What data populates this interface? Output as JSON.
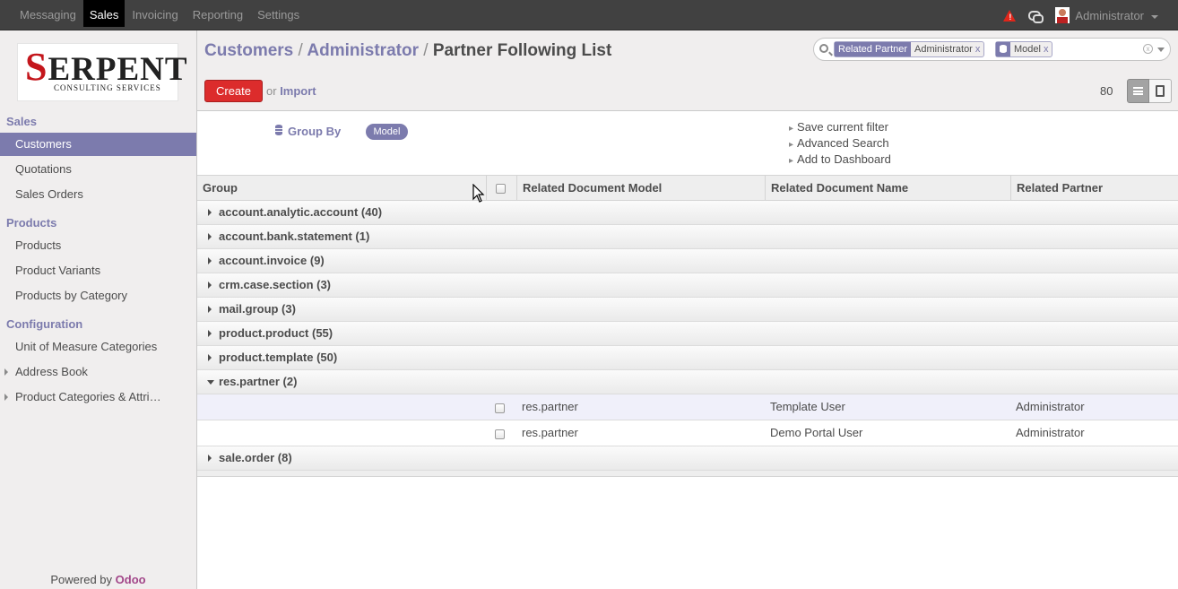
{
  "topbar": {
    "menu": [
      "Messaging",
      "Sales",
      "Invoicing",
      "Reporting",
      "Settings"
    ],
    "active": "Sales",
    "alert_glyph": "!",
    "user": "Administrator"
  },
  "sidebar": {
    "logo_big_first": "S",
    "logo_big_rest": "ERPENT",
    "logo_small": "CONSULTING SERVICES",
    "sections": [
      {
        "title": "Sales",
        "items": [
          "Customers",
          "Quotations",
          "Sales Orders"
        ]
      },
      {
        "title": "Products",
        "items": [
          "Products",
          "Product Variants",
          "Products by Category"
        ]
      },
      {
        "title": "Configuration",
        "items": [
          "Unit of Measure Categories",
          "Address Book",
          "Product Categories & Attri…"
        ]
      }
    ],
    "active_item": "Customers",
    "powered_prefix": "Powered by ",
    "powered_brand": "Odoo"
  },
  "header": {
    "crumb1": "Customers",
    "crumb2": "Administrator",
    "crumb3": "Partner Following List",
    "sep": "/",
    "create_label": "Create",
    "or_label": "or",
    "import_label": "Import",
    "record_count": "80"
  },
  "search": {
    "facet1_label": "Related Partner",
    "facet1_value": "Administrator",
    "facet2_value": "Model",
    "remove": "x",
    "clear": "x"
  },
  "filters": {
    "group_by_label": "Group By",
    "group_by_tag": "Model",
    "options": [
      "Save current filter",
      "Advanced Search",
      "Add to Dashboard"
    ]
  },
  "table": {
    "columns": [
      "Group",
      "Related Document Model",
      "Related Document Name",
      "Related Partner"
    ],
    "groups": [
      "account.analytic.account (40)",
      "account.bank.statement (1)",
      "account.invoice (9)",
      "crm.case.section (3)",
      "mail.group (3)",
      "product.product (55)",
      "product.template (50)",
      "res.partner (2)",
      "sale.order (8)"
    ],
    "rows": [
      {
        "model": "res.partner",
        "name": "Template User",
        "partner": "Administrator"
      },
      {
        "model": "res.partner",
        "name": "Demo Portal User",
        "partner": "Administrator"
      }
    ]
  },
  "colors": {
    "accent": "#7c7bad",
    "topbar": "#414141",
    "create": "#dc2c2c"
  }
}
